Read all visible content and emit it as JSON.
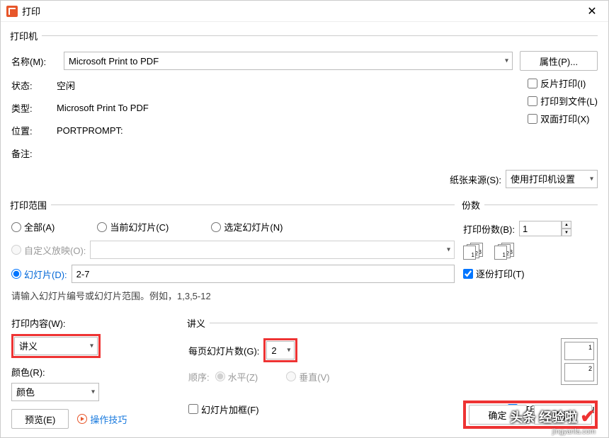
{
  "window": {
    "title": "打印"
  },
  "printer": {
    "legend": "打印机",
    "name_label": "名称(M):",
    "name_value": "Microsoft Print to PDF",
    "properties_btn": "属性(P)...",
    "status_label": "状态:",
    "status_value": "空闲",
    "type_label": "类型:",
    "type_value": "Microsoft Print To PDF",
    "location_label": "位置:",
    "location_value": "PORTPROMPT:",
    "comment_label": "备注:",
    "reverse_print": "反片打印(I)",
    "print_to_file": "打印到文件(L)",
    "duplex": "双面打印(X)",
    "paper_source_label": "纸张来源(S):",
    "paper_source_value": "使用打印机设置"
  },
  "range": {
    "legend": "打印范围",
    "all": "全部(A)",
    "current": "当前幻灯片(C)",
    "selected": "选定幻灯片(N)",
    "custom_show": "自定义放映(O):",
    "slides": "幻灯片(D):",
    "slides_value": "2-7",
    "hint": "请输入幻灯片编号或幻灯片范围。例如，1,3,5-12"
  },
  "copies": {
    "legend": "份数",
    "count_label": "打印份数(B):",
    "count_value": "1",
    "collate": "逐份打印(T)"
  },
  "content": {
    "label": "打印内容(W):",
    "value": "讲义",
    "color_label": "颜色(R):",
    "color_value": "颜色"
  },
  "handout": {
    "legend": "讲义",
    "per_page_label": "每页幻灯片数(G):",
    "per_page_value": "2",
    "order_label": "顺序:",
    "horizontal": "水平(Z)",
    "vertical": "垂直(V)",
    "frame": "幻灯片加框(F)",
    "hidden": "打印隐藏幻灯片(H)"
  },
  "footer": {
    "preview": "预览(E)",
    "tips": "操作技巧",
    "ok": "确定",
    "cancel": "取消"
  },
  "watermark": {
    "text": "头条 经验啦",
    "sub": "jingyanla.com"
  }
}
